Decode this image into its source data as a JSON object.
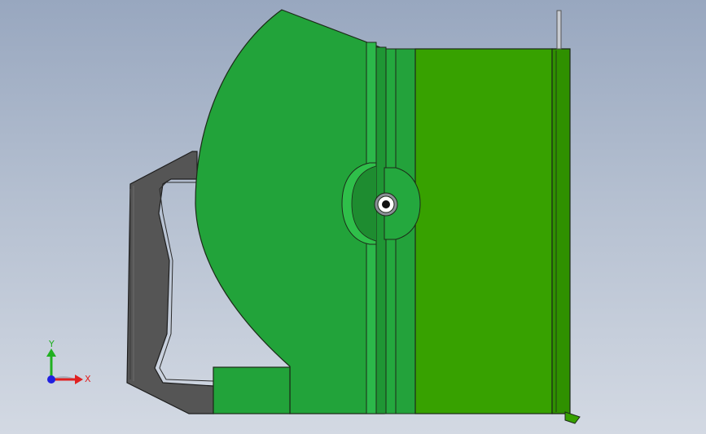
{
  "viewport": {
    "name": "3d-model-viewport"
  },
  "colors": {
    "background_top": "#98a7bf",
    "background_bottom": "#d3d9e3",
    "housing_green": "#22a33a",
    "panel_green": "#37a100",
    "dark_green": "#1a7a2a",
    "handle_gray": "#555555",
    "outline": "#1c2a18",
    "axis_x": "#e02020",
    "axis_y": "#20b020",
    "axis_z": "#2020e0"
  },
  "triad": {
    "x_label": "X",
    "y_label": "Y"
  }
}
